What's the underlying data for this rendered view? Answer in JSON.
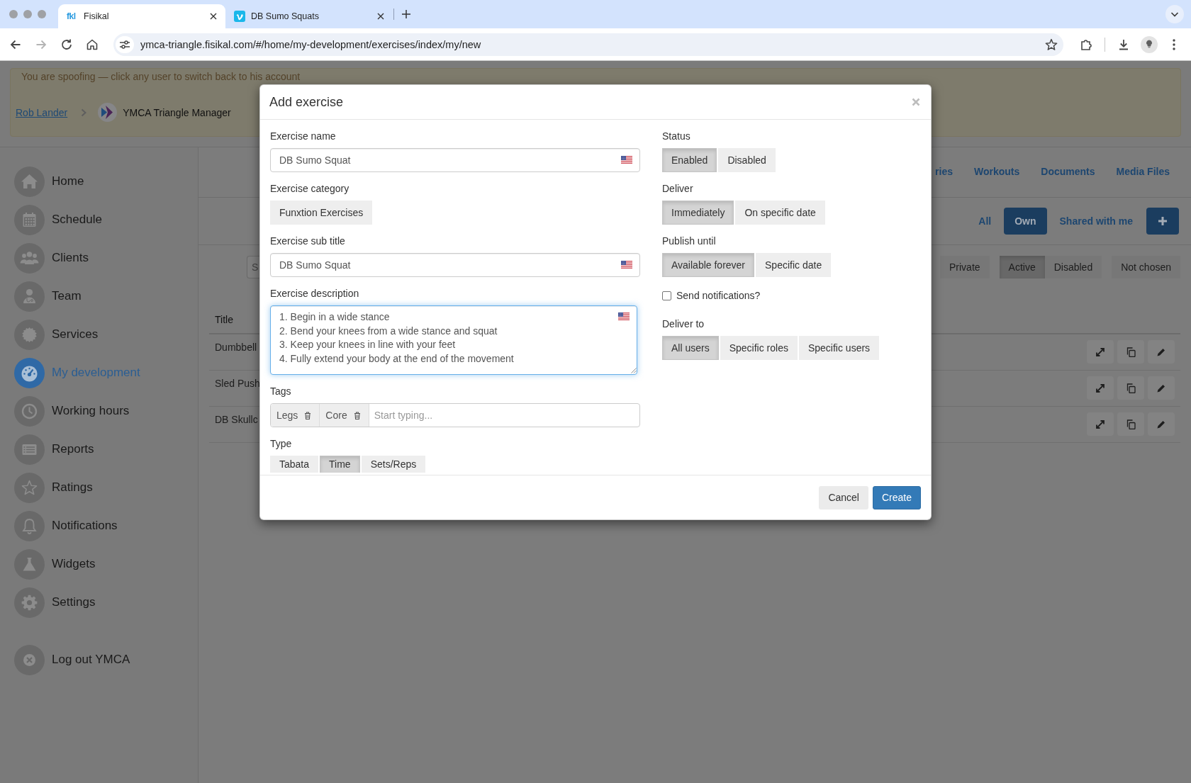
{
  "browser": {
    "tabs": [
      {
        "favicon": "fkl",
        "title": "Fisikal",
        "selected": true
      },
      {
        "title": "DB Sumo Squats",
        "selected": false
      }
    ],
    "back": {
      "disabled": false
    },
    "forward": {
      "disabled": true
    },
    "url": "ymca-triangle.fisikal.com/#/home/my-development/exercises/index/my/new"
  },
  "banner": {
    "message": "You are spoofing — click any user to switch back to his account",
    "user": "Rob Lander",
    "account": "YMCA Triangle Manager"
  },
  "sidebar": {
    "items": [
      {
        "label": "Home",
        "selected": false
      },
      {
        "label": "Schedule",
        "selected": false
      },
      {
        "label": "Clients",
        "selected": false
      },
      {
        "label": "Team",
        "selected": false
      },
      {
        "label": "Services",
        "selected": false
      },
      {
        "label": "My development",
        "selected": true
      },
      {
        "label": "Working hours",
        "selected": false
      },
      {
        "label": "Reports",
        "selected": false
      },
      {
        "label": "Ratings",
        "selected": false
      },
      {
        "label": "Notifications",
        "selected": false
      },
      {
        "label": "Widgets",
        "selected": false
      },
      {
        "label": "Settings",
        "selected": false
      }
    ],
    "logout": "Log out YMCA"
  },
  "content": {
    "tabs": [
      {
        "label": "ries",
        "selected": false
      },
      {
        "label": "Workouts",
        "selected": false
      },
      {
        "label": "Documents",
        "selected": false
      },
      {
        "label": "Media Files",
        "selected": false
      }
    ],
    "scope": [
      {
        "label": "All",
        "selected": false
      },
      {
        "label": "Own",
        "selected": true
      },
      {
        "label": "Shared with me",
        "selected": false
      }
    ],
    "search": {
      "placeholder": "S"
    },
    "filter_groups": [
      [
        {
          "label": "Private",
          "selected": false
        }
      ],
      [
        {
          "label": "Active",
          "selected": true
        },
        {
          "label": "Disabled",
          "selected": false
        }
      ],
      [
        {
          "label": "Not chosen",
          "selected": false
        }
      ]
    ],
    "table": {
      "columns": [
        "Title"
      ],
      "rows": [
        [
          "Dumbbell"
        ],
        [
          "Sled Push"
        ],
        [
          "DB Skullc"
        ]
      ]
    }
  },
  "modal": {
    "title": "Add exercise",
    "columns": [
      [
        {
          "kind": "input",
          "label": "Exercise name",
          "value": "DB Sumo Squat"
        },
        {
          "kind": "button",
          "label": "Exercise category",
          "value": "Funxtion Exercises"
        },
        {
          "kind": "input",
          "label": "Exercise sub title",
          "value": "DB Sumo Squat"
        },
        {
          "kind": "textarea",
          "label": "Exercise description",
          "value": "1. Begin in a wide stance\n2. Bend your knees from a wide stance and squat\n3. Keep your knees in line with your feet\n4. Fully extend your body at the end of the movement",
          "focused": true
        },
        {
          "kind": "tags",
          "label": "Tags",
          "tags": [
            "Legs",
            "Core"
          ],
          "placeholder": "Start typing..."
        },
        {
          "kind": "choice",
          "label": "Type",
          "options": [
            {
              "label": "Tabata",
              "selected": false
            },
            {
              "label": "Time",
              "selected": true
            },
            {
              "label": "Sets/Reps",
              "selected": false
            }
          ]
        }
      ],
      [
        {
          "kind": "choice",
          "label": "Status",
          "options": [
            {
              "label": "Enabled",
              "selected": true
            },
            {
              "label": "Disabled",
              "selected": false
            }
          ]
        },
        {
          "kind": "choice",
          "label": "Deliver",
          "options": [
            {
              "label": "Immediately",
              "selected": true
            },
            {
              "label": "On specific date",
              "selected": false
            }
          ]
        },
        {
          "kind": "choice",
          "label": "Publish until",
          "options": [
            {
              "label": "Available forever",
              "selected": true
            },
            {
              "label": "Specific date",
              "selected": false
            }
          ]
        },
        {
          "kind": "checkbox",
          "label": "Send notifications?",
          "checked": false
        },
        {
          "kind": "choice",
          "label": "Deliver to",
          "options": [
            {
              "label": "All users",
              "selected": true
            },
            {
              "label": "Specific roles",
              "selected": false
            },
            {
              "label": "Specific users",
              "selected": false
            }
          ]
        }
      ]
    ],
    "buttons": [
      {
        "label": "Cancel",
        "kind": "default"
      },
      {
        "label": "Create",
        "kind": "primary"
      }
    ]
  }
}
